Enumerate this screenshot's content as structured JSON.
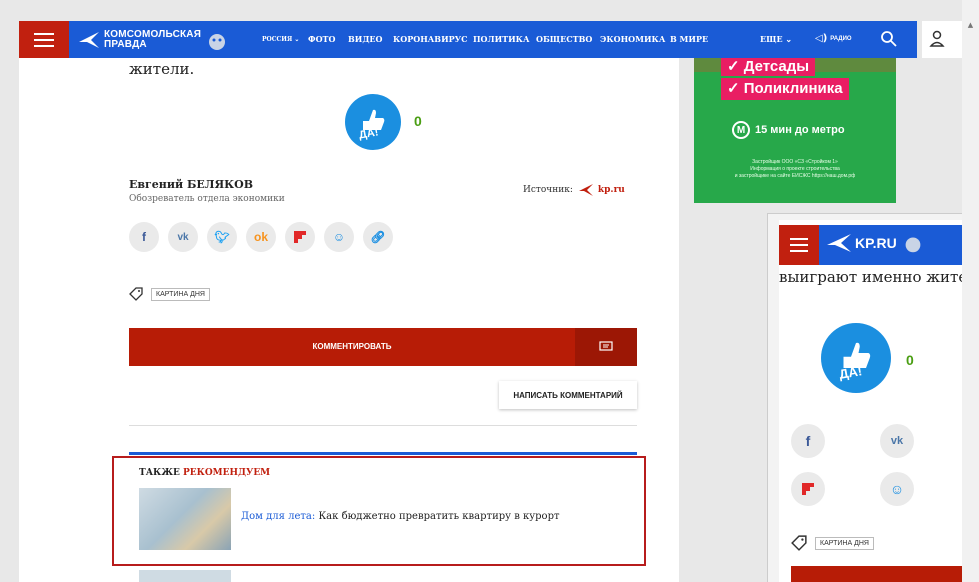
{
  "nav": {
    "logo_line1": "КОМСОМОЛЬСКАЯ",
    "logo_line2": "ПРАВДА",
    "logo_badge": "RU",
    "region": "РОССИЯ",
    "items": [
      "ФОТО",
      "ВИДЕО",
      "КОРОНАВИРУС",
      "ПОЛИТИКА",
      "ОБЩЕСТВО",
      "ЭКОНОМИКА",
      "В МИРЕ"
    ],
    "more": "ЕЩЕ",
    "radio": "РАДИО"
  },
  "article": {
    "tail_text": "жители.",
    "like_label": "ДА!",
    "like_count": "0",
    "author_name": "Евгений БЕЛЯКОВ",
    "author_role": "Обозреватель отдела экономики",
    "source_label": "Источник:",
    "source_site": "kp.ru",
    "share_icons": [
      "facebook-icon",
      "vk-icon",
      "twitter-icon",
      "odnoklassniki-icon",
      "flipboard-icon",
      "mail-agent-icon",
      "copy-link-icon"
    ],
    "tag": "КАРТИНА ДНЯ",
    "comment_button": "КОММЕНТИРОВАТЬ",
    "write_comment_button": "НАПИСАТЬ КОММЕНТАРИЙ"
  },
  "recommend": {
    "title_black": "ТАКЖЕ",
    "title_red": "РЕКОМЕНДУЕМ",
    "item_category": "Дом для лета:",
    "item_text": "Как бюджетно превратить квартиру в курорт"
  },
  "ad": {
    "line1": "✓ Детсады",
    "line2": "✓ Поликлиника",
    "metro_icon": "М",
    "metro": "15 мин до метро",
    "fine1": "Застройщик ООО «СЗ «Стройком 1»",
    "fine2": "Информация о проекте строительства",
    "fine3": "и застройщике на сайте ЕИСЖС https://наш.дом.рф"
  },
  "preview": {
    "logo": "KP.RU",
    "logo_badge": "RU",
    "text": "выиграют именно жители.",
    "like_label": "ДА!",
    "like_count": "0",
    "tag": "КАРТИНА ДНЯ"
  },
  "colors": {
    "nav_blue": "#1a5bd6",
    "brand_red": "#c1200f",
    "like_blue": "#1b8fe0",
    "like_green": "#4a9e13",
    "ad_green": "#27a84a",
    "ad_pink": "#e91e63"
  }
}
